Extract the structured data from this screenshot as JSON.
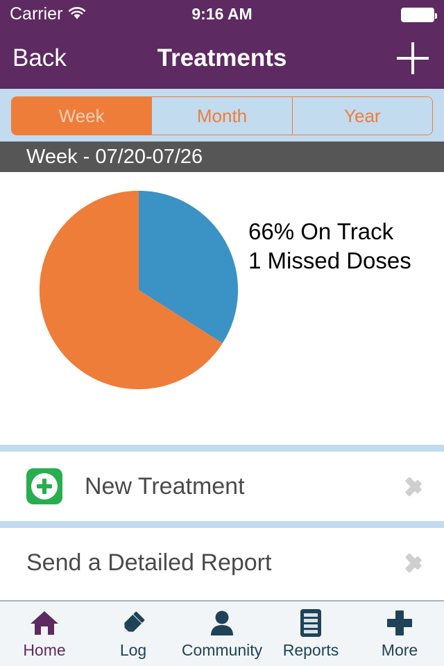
{
  "status_bar": {
    "carrier": "Carrier",
    "wifi_icon": "wifi-icon",
    "time": "9:16 AM",
    "battery_icon": "battery-icon"
  },
  "nav_bar": {
    "back_label": "Back",
    "title": "Treatments",
    "add_icon": "plus-icon"
  },
  "segmented_control": {
    "options": [
      {
        "label": "Week",
        "selected": true
      },
      {
        "label": "Month",
        "selected": false
      },
      {
        "label": "Year",
        "selected": false
      }
    ]
  },
  "period_bar": {
    "label": "Week - 07/20-07/26"
  },
  "chart_data": {
    "type": "pie",
    "title": "",
    "categories": [
      "On Track",
      "Missed"
    ],
    "values": [
      66,
      34
    ],
    "colors": [
      "#EE7D3A",
      "#3B92C4"
    ],
    "start_angle_deg": 0,
    "direction": "clockwise",
    "legend_position": "right",
    "annotations": [
      "66% On Track",
      "1 Missed Doses"
    ]
  },
  "chart_summary": {
    "on_track_line": "66% On Track",
    "missed_line": "1 Missed Doses"
  },
  "list_rows": [
    {
      "label": "New Treatment",
      "icon": "green-plus-icon",
      "has_icon": true,
      "accessory": "chevron-right-icon"
    },
    {
      "label": "Send a Detailed Report",
      "icon": null,
      "has_icon": false,
      "accessory": "chevron-right-icon"
    }
  ],
  "tab_bar": {
    "items": [
      {
        "label": "Home",
        "icon": "home-icon",
        "selected": true
      },
      {
        "label": "Log",
        "icon": "pencil-icon",
        "selected": false
      },
      {
        "label": "Community",
        "icon": "person-icon",
        "selected": false
      },
      {
        "label": "Reports",
        "icon": "document-icon",
        "selected": false
      },
      {
        "label": "More",
        "icon": "plus-icon",
        "selected": false
      }
    ]
  },
  "colors": {
    "brand_purple": "#5D2A61",
    "accent_orange": "#EE7D3A",
    "chart_blue": "#3B92C4",
    "light_blue": "#C2DBEE",
    "period_gray": "#565656",
    "green": "#27AE4E",
    "tab_inactive": "#1F4257"
  }
}
